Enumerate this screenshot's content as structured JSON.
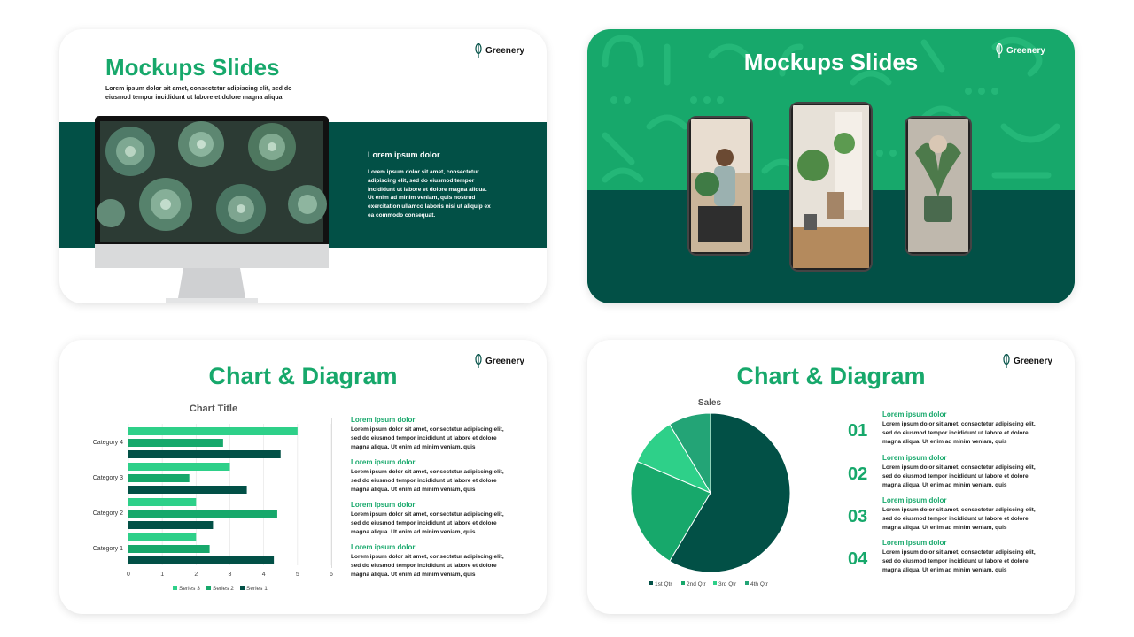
{
  "brand": {
    "name": "Greenery"
  },
  "colors": {
    "accent": "#17a86b",
    "dark": "#025046",
    "light": "#2ed089"
  },
  "slide1": {
    "title": "Mockups Slides",
    "subtitle": "Lorem ipsum dolor sit amet, consectetur adipiscing elit, sed do eiusmod tempor incididunt ut labore et dolore magna aliqua.",
    "card_title": "Lorem ipsum dolor",
    "card_body": "Lorem ipsum dolor sit amet, consectetur adipiscing elit, sed do eiusmod tempor incididunt ut labore et dolore magna aliqua. Ut enim ad minim veniam, quis nostrud exercitation ullamco laboris nisi ut aliquip ex ea commodo consequat."
  },
  "slide2": {
    "title": "Mockups Slides"
  },
  "slide3": {
    "title": "Chart & Diagram",
    "blocks": [
      {
        "heading": "Lorem ipsum dolor",
        "body": "Lorem ipsum dolor sit amet, consectetur adipiscing elit, sed do eiusmod tempor incididunt ut labore et dolore magna aliqua. Ut enim ad minim veniam, quis"
      },
      {
        "heading": "Lorem ipsum dolor",
        "body": "Lorem ipsum dolor sit amet, consectetur adipiscing elit, sed do eiusmod tempor incididunt ut labore et dolore magna aliqua. Ut enim ad minim veniam, quis"
      },
      {
        "heading": "Lorem ipsum dolor",
        "body": "Lorem ipsum dolor sit amet, consectetur adipiscing elit, sed do eiusmod tempor incididunt ut labore et dolore magna aliqua. Ut enim ad minim veniam, quis"
      },
      {
        "heading": "Lorem ipsum dolor",
        "body": "Lorem ipsum dolor sit amet, consectetur adipiscing elit, sed do eiusmod tempor incididunt ut labore et dolore magna aliqua. Ut enim ad minim veniam, quis"
      }
    ]
  },
  "slide4": {
    "title": "Chart & Diagram",
    "blocks": [
      {
        "num": "01",
        "heading": "Lorem ipsum dolor",
        "body": "Lorem ipsum dolor sit amet, consectetur adipiscing elit, sed do eiusmod tempor incididunt ut labore et dolore magna aliqua. Ut enim ad minim veniam, quis"
      },
      {
        "num": "02",
        "heading": "Lorem ipsum dolor",
        "body": "Lorem ipsum dolor sit amet, consectetur adipiscing elit, sed do eiusmod tempor incididunt ut labore et dolore magna aliqua. Ut enim ad minim veniam, quis"
      },
      {
        "num": "03",
        "heading": "Lorem ipsum dolor",
        "body": "Lorem ipsum dolor sit amet, consectetur adipiscing elit, sed do eiusmod tempor incididunt ut labore et dolore magna aliqua. Ut enim ad minim veniam, quis"
      },
      {
        "num": "04",
        "heading": "Lorem ipsum dolor",
        "body": "Lorem ipsum dolor sit amet, consectetur adipiscing elit, sed do eiusmod tempor incididunt ut labore et dolore magna aliqua. Ut enim ad minim veniam, quis"
      }
    ]
  },
  "chart_data": [
    {
      "type": "bar",
      "orientation": "horizontal",
      "title": "Chart Title",
      "categories": [
        "Category 1",
        "Category 2",
        "Category 3",
        "Category 4"
      ],
      "series": [
        {
          "name": "Series 1",
          "values": [
            4.3,
            2.5,
            3.5,
            4.5
          ],
          "color": "#025046"
        },
        {
          "name": "Series 2",
          "values": [
            2.4,
            4.4,
            1.8,
            2.8
          ],
          "color": "#17a86b"
        },
        {
          "name": "Series 3",
          "values": [
            2.0,
            2.0,
            3.0,
            5.0
          ],
          "color": "#2ed089"
        }
      ],
      "xlim": [
        0,
        6
      ],
      "xticks": [
        "0",
        "1",
        "2",
        "3",
        "4",
        "5",
        "6"
      ],
      "legend": "bottom"
    },
    {
      "type": "pie",
      "title": "Sales",
      "categories": [
        "1st Qtr",
        "2nd Qtr",
        "3rd Qtr",
        "4th Qtr"
      ],
      "values": [
        8.2,
        3.2,
        1.4,
        1.2
      ],
      "colors": [
        "#025046",
        "#17a86b",
        "#2ed089",
        "#23a476"
      ],
      "legend": "bottom"
    }
  ]
}
